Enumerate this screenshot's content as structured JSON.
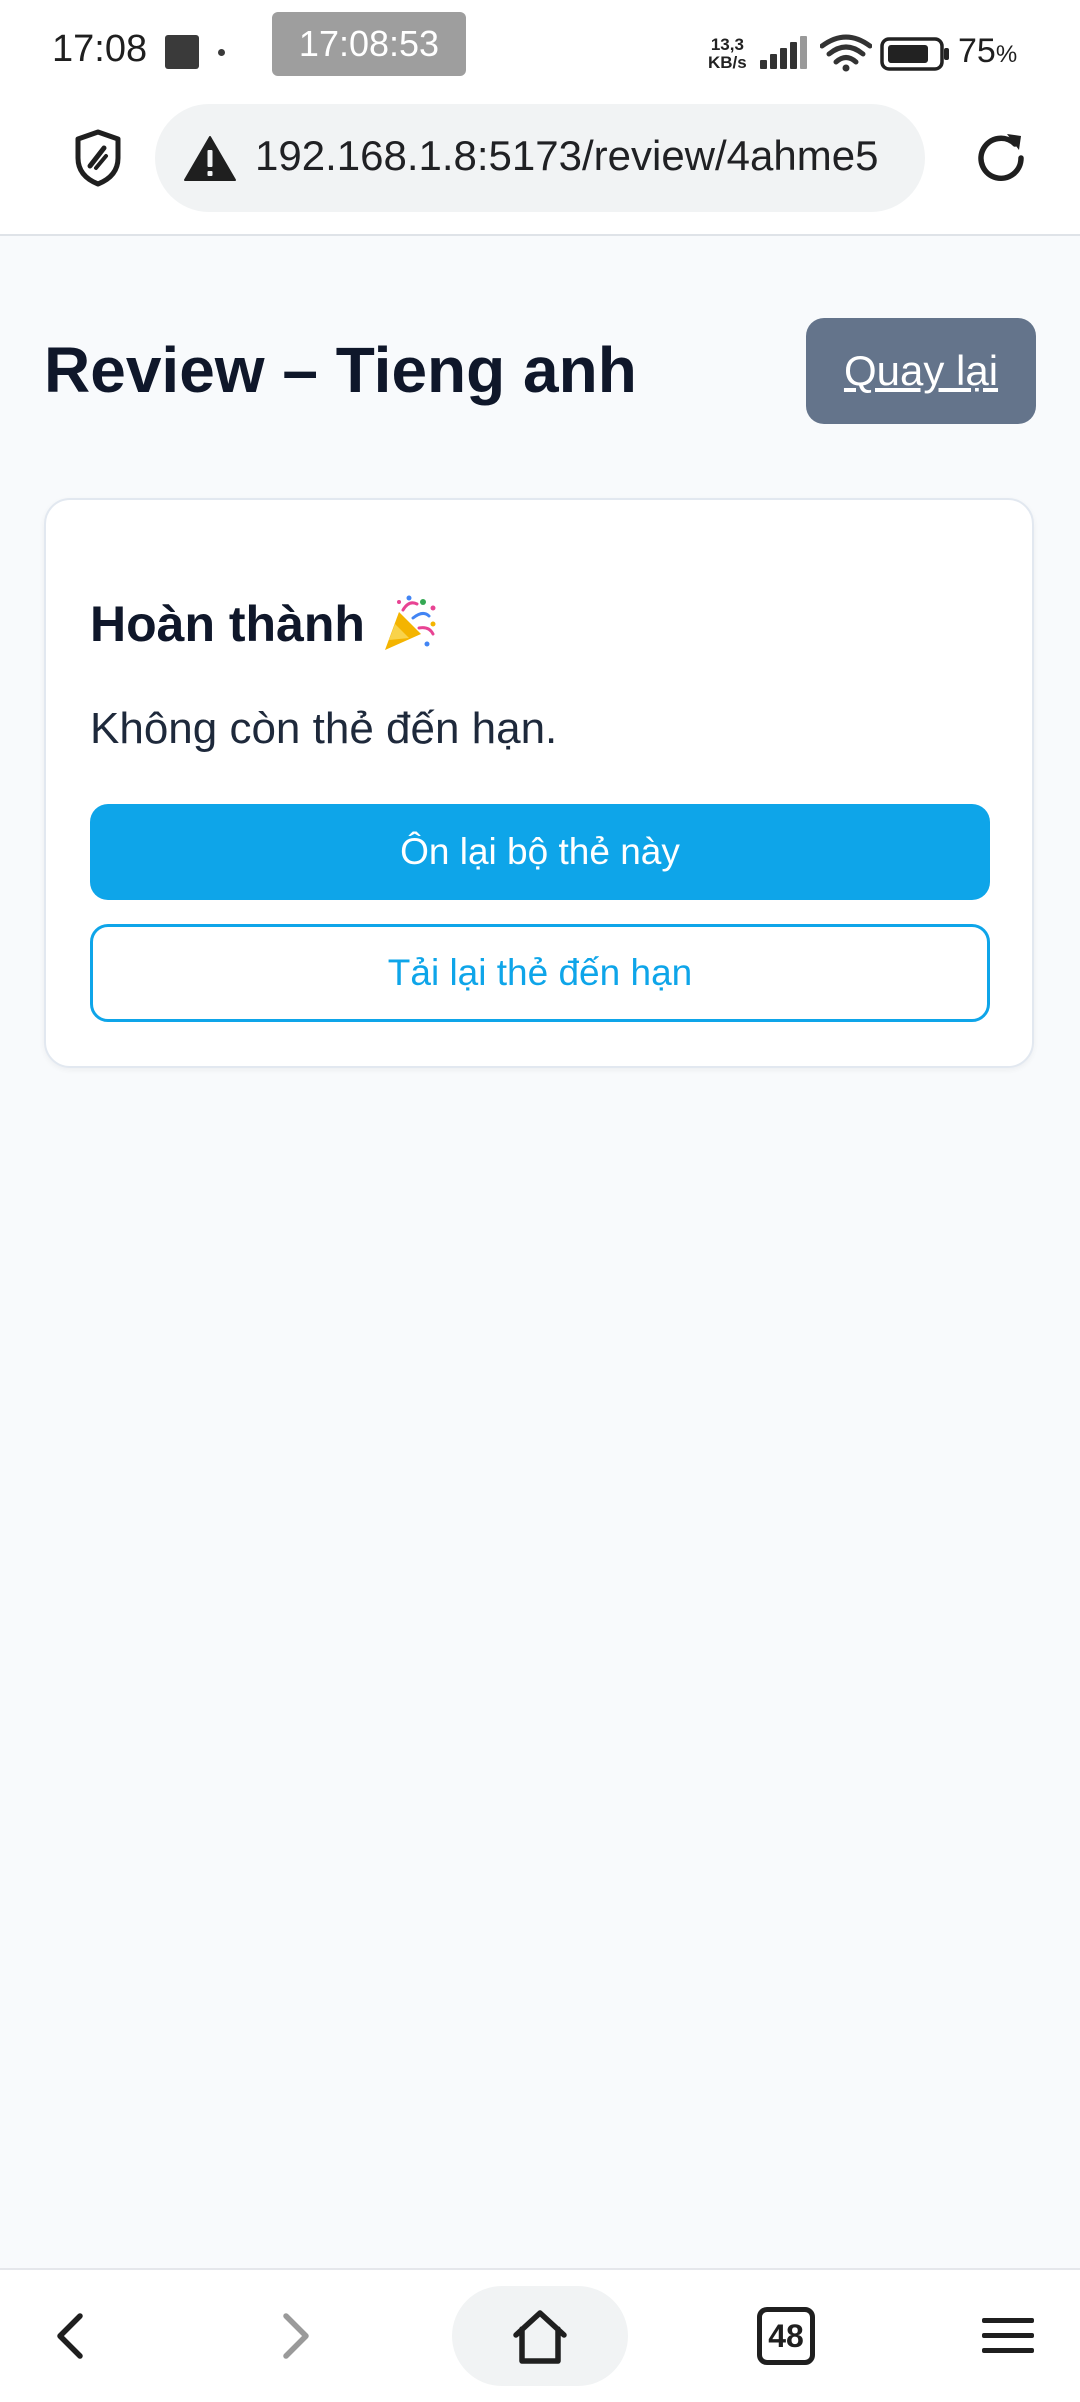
{
  "status_bar": {
    "time": "17:08",
    "screen_record_time": "17:08:53",
    "net_speed_value": "13,3",
    "net_speed_unit": "KB/s",
    "battery_value": "75",
    "battery_unit": "%"
  },
  "browser": {
    "url": "192.168.1.8:5173/review/4ahme5",
    "tab_count": "48"
  },
  "page": {
    "title": "Review – Tieng anh",
    "back_label": "Quay lại"
  },
  "card": {
    "title": "Hoàn thành",
    "message": "Không còn thẻ đến hạn.",
    "primary_button": "Ôn lại bộ thẻ này",
    "secondary_button": "Tải lại thẻ đến hạn"
  },
  "colors": {
    "accent": "#0ea5e9",
    "back_button_bg": "#64748b",
    "page_bg": "#f8fafc",
    "text_dark": "#0f172a"
  },
  "icons": {
    "party": "party-popper-icon",
    "shield": "shield-icon",
    "warning": "warning-icon",
    "reload": "reload-icon",
    "back": "chevron-left-icon",
    "forward": "chevron-right-icon",
    "home": "home-icon",
    "tabs": "tabs-icon",
    "menu": "menu-icon"
  }
}
